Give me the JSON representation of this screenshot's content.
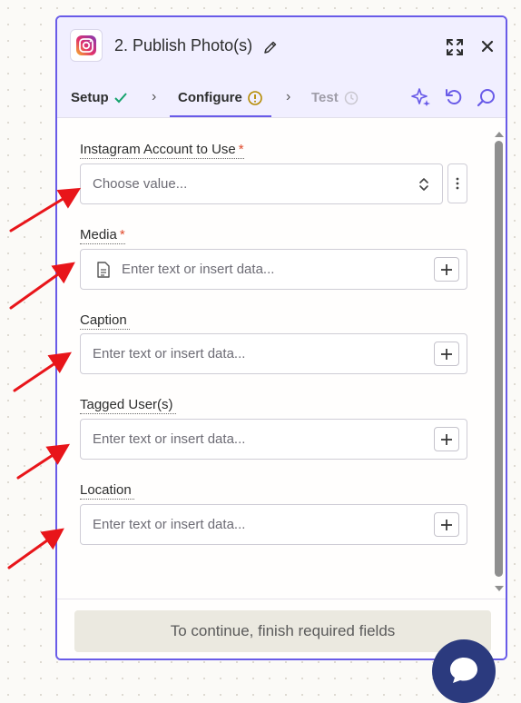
{
  "header": {
    "title": "2. Publish Photo(s)",
    "icons": [
      "instagram-logo",
      "pencil-icon",
      "expand-icon",
      "close-icon"
    ]
  },
  "tabs": [
    {
      "label": "Setup",
      "state": "complete",
      "icon": "check-icon"
    },
    {
      "label": "Configure",
      "state": "active-warning",
      "icon": "warning-icon"
    },
    {
      "label": "Test",
      "state": "disabled",
      "icon": "clock-icon"
    }
  ],
  "toolbar": {
    "icons": [
      "sparkle-icon",
      "refresh-icon",
      "search-icon"
    ]
  },
  "fields": [
    {
      "label": "Instagram Account to Use",
      "required": "*",
      "placeholder": "Choose value...",
      "type": "select"
    },
    {
      "label": "Media",
      "required": "*",
      "placeholder": "Enter text or insert data...",
      "type": "text"
    },
    {
      "label": "Caption",
      "required": "",
      "placeholder": "Enter text or insert data...",
      "type": "text"
    },
    {
      "label": "Tagged User(s)",
      "required": "",
      "placeholder": "Enter text or insert data...",
      "type": "text"
    },
    {
      "label": "Location",
      "required": "",
      "placeholder": "Enter text or insert data...",
      "type": "text"
    }
  ],
  "footer": {
    "button_label": "To continue, finish required fields"
  },
  "colors": {
    "accent": "#695be8",
    "required": "#e04a2c",
    "success": "#14a26c",
    "warning": "#b48a00",
    "chat": "#2b3a7e",
    "annotation": "#e8151a"
  }
}
